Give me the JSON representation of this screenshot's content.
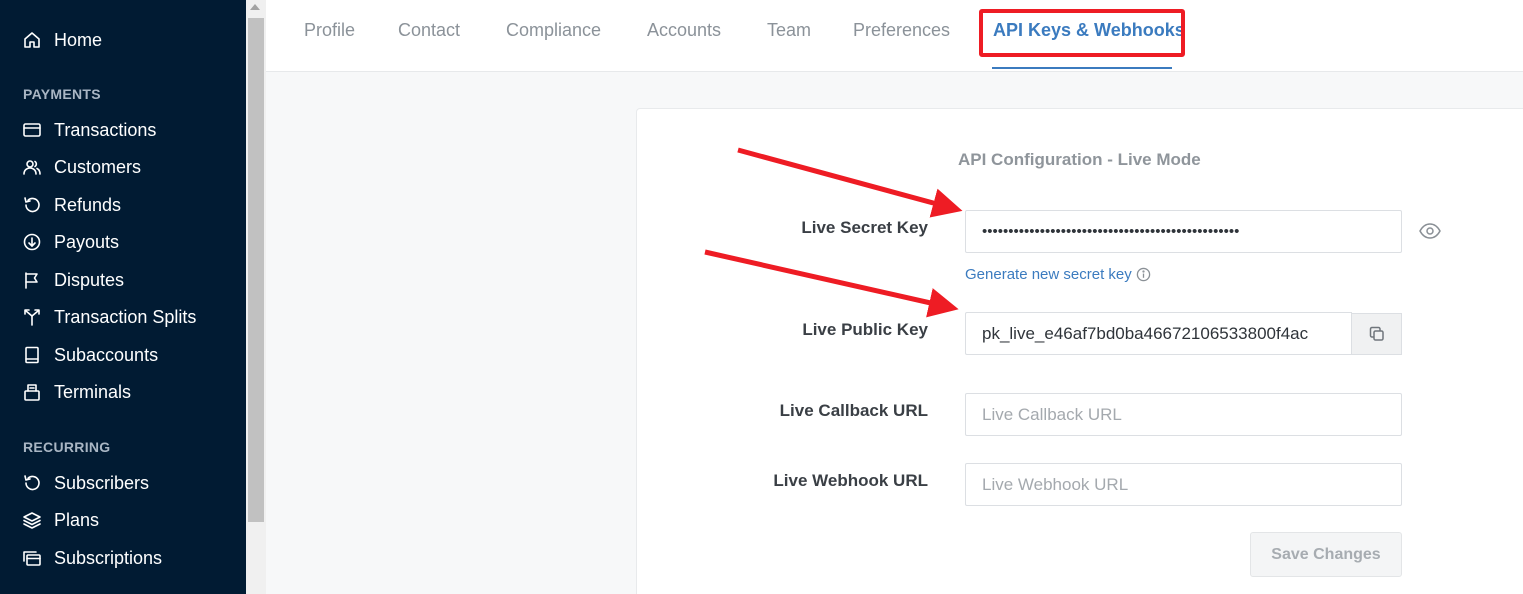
{
  "sidebar": {
    "home": "Home",
    "payments_title": "PAYMENTS",
    "payments": [
      "Transactions",
      "Customers",
      "Refunds",
      "Payouts",
      "Disputes",
      "Transaction Splits",
      "Subaccounts",
      "Terminals"
    ],
    "recurring_title": "RECURRING",
    "recurring": [
      "Subscribers",
      "Plans",
      "Subscriptions"
    ]
  },
  "tabs": [
    "Profile",
    "Contact",
    "Compliance",
    "Accounts",
    "Team",
    "Preferences",
    "API Keys & Webhooks"
  ],
  "active_tab": "API Keys & Webhooks",
  "config": {
    "title": "API Configuration - Live Mode",
    "secret_label": "Live Secret Key",
    "secret_value": "•••••••••••••••••••••••••••••••••••••••••••••••••",
    "generate_link": "Generate new secret key",
    "public_label": "Live Public Key",
    "public_value": "pk_live_e46af7bd0ba46672106533800f4ac",
    "callback_label": "Live Callback URL",
    "callback_placeholder": "Live Callback URL",
    "webhook_label": "Live Webhook URL",
    "webhook_placeholder": "Live Webhook URL",
    "save_label": "Save Changes"
  },
  "colors": {
    "sidebar_bg": "#011b33",
    "accent": "#3b7bbf",
    "annotation": "#ee1c24"
  }
}
